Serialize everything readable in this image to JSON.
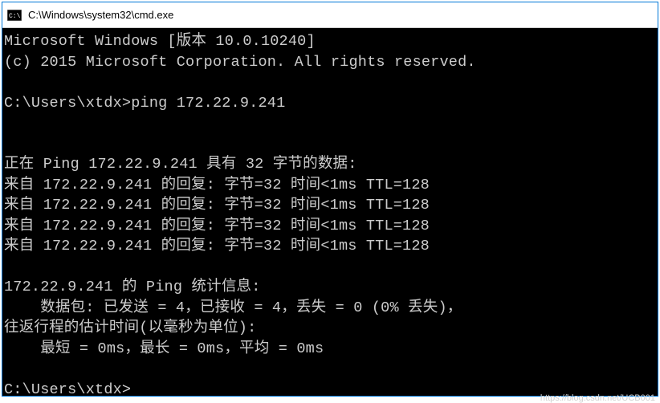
{
  "window": {
    "title": "C:\\Windows\\system32\\cmd.exe"
  },
  "terminal": {
    "header1": "Microsoft Windows [版本 10.0.10240]",
    "header2": "(c) 2015 Microsoft Corporation. All rights reserved.",
    "blank": "",
    "prompt1": "C:\\Users\\xtdx>",
    "command1": "ping 172.22.9.241",
    "pinging": "正在 Ping 172.22.9.241 具有 32 字节的数据:",
    "reply1": "来自 172.22.9.241 的回复: 字节=32 时间<1ms TTL=128",
    "reply2": "来自 172.22.9.241 的回复: 字节=32 时间<1ms TTL=128",
    "reply3": "来自 172.22.9.241 的回复: 字节=32 时间<1ms TTL=128",
    "reply4": "来自 172.22.9.241 的回复: 字节=32 时间<1ms TTL=128",
    "stats_header": "172.22.9.241 的 Ping 统计信息:",
    "stats_packets": "    数据包: 已发送 = 4，已接收 = 4，丢失 = 0 (0% 丢失)，",
    "stats_rtt_header": "往返行程的估计时间(以毫秒为单位):",
    "stats_rtt": "    最短 = 0ms，最长 = 0ms，平均 = 0ms",
    "prompt2": "C:\\Users\\xtdx>"
  },
  "watermark": "https://blog.csdn.net/UCB001"
}
